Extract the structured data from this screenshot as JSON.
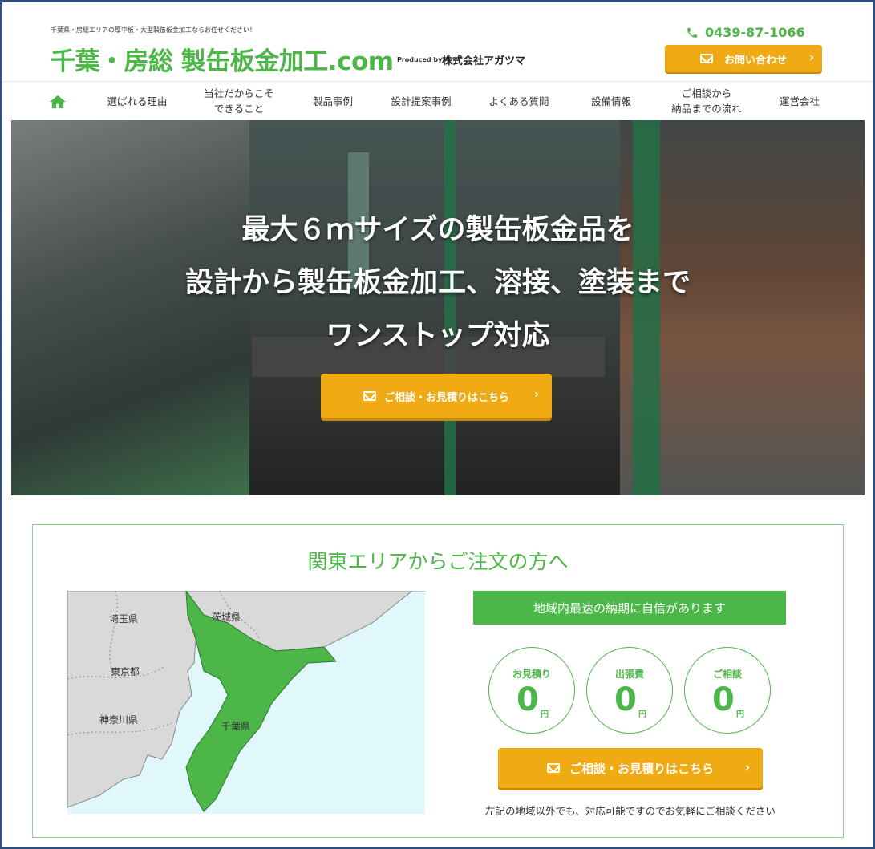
{
  "header": {
    "tagline": "千葉県・房総エリアの厚中板・大型製缶板金加工ならお任せください！",
    "logo": "千葉・房総 製缶板金加工.com",
    "produced_by": "Produced by",
    "company": "株式会社アガツマ",
    "phone": "0439-87-1066",
    "contact_button": "お問い合わせ",
    "accent_color": "#4cb648",
    "button_color": "#f0aa14"
  },
  "nav": {
    "home_icon": "home-icon",
    "items": [
      {
        "label": "選ばれる理由"
      },
      {
        "label": "当社だからこそ\nできること"
      },
      {
        "label": "製品事例"
      },
      {
        "label": "設計提案事例"
      },
      {
        "label": "よくある質問"
      },
      {
        "label": "設備情報"
      },
      {
        "label": "ご相談から\n納品までの流れ"
      },
      {
        "label": "運営会社"
      }
    ]
  },
  "hero": {
    "line1": "最大６ｍサイズの製缶板金品を",
    "line2": "設計から製缶板金加工、溶接、塗装まで",
    "line3": "ワンストップ対応",
    "button": "ご相談・お見積りはこちら"
  },
  "kanto": {
    "title": "関東エリアからご注文の方へ",
    "map_labels": {
      "saitama": "埼玉県",
      "ibaraki": "茨城県",
      "tokyo": "東京都",
      "kanagawa": "神奈川県",
      "chiba": "千葉県"
    },
    "banner": "地域内最速の納期に自信があります",
    "circles": [
      {
        "label": "お見積り",
        "value": "0",
        "unit": "円"
      },
      {
        "label": "出張費",
        "value": "0",
        "unit": "円"
      },
      {
        "label": "ご相談",
        "value": "0",
        "unit": "円"
      }
    ],
    "button": "ご相談・お見積りはこちら",
    "note": "左記の地域以外でも、対応可能ですのでお気軽にご相談ください"
  }
}
